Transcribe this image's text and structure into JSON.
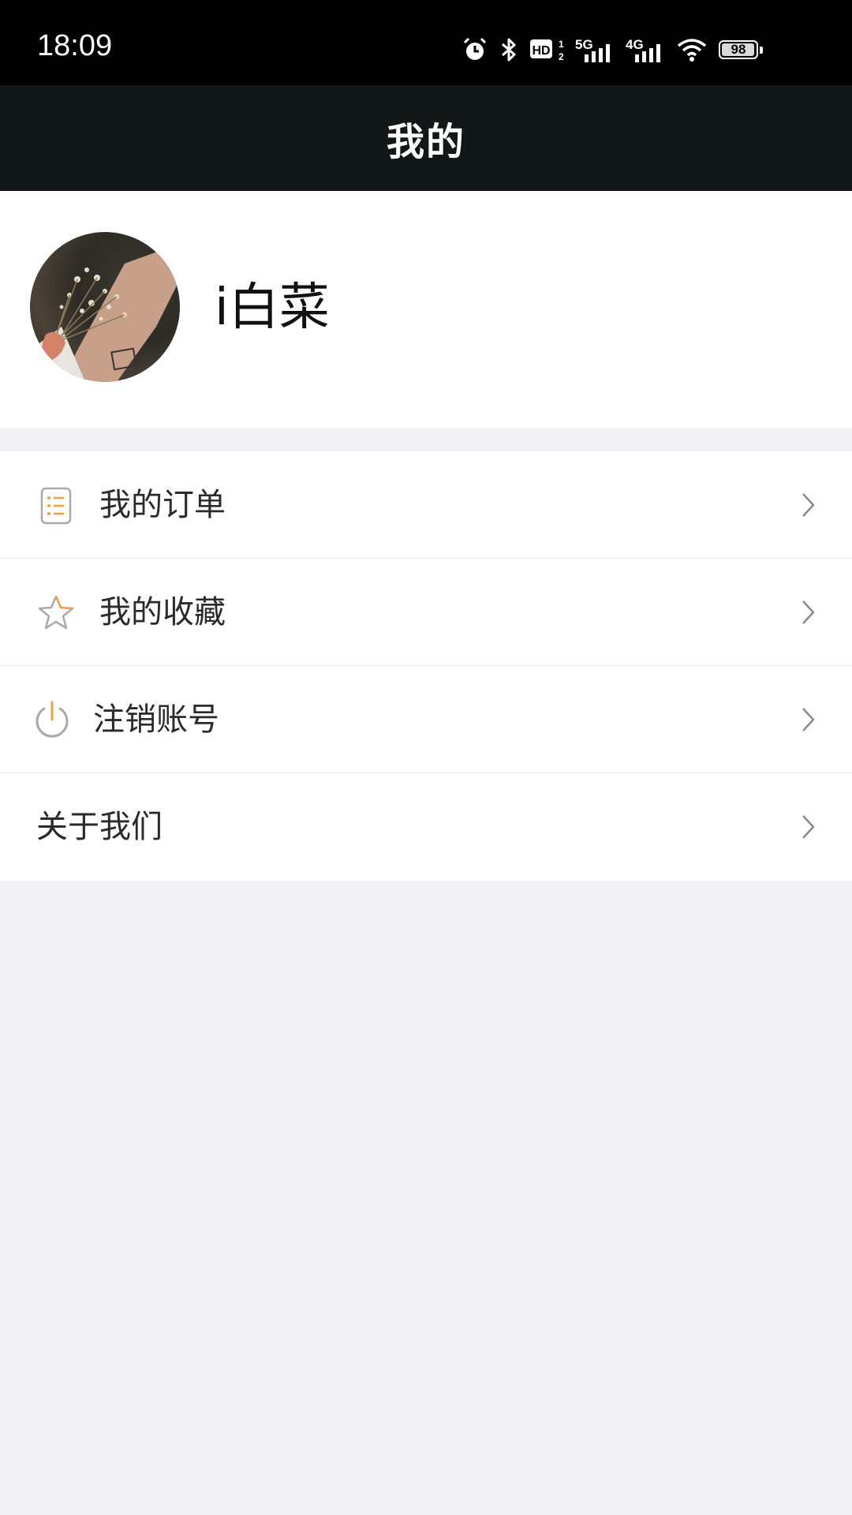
{
  "status_bar": {
    "time": "18:09",
    "network_labels": [
      "5G",
      "4G"
    ],
    "hd_label": "HD",
    "battery_level": "98",
    "icons": [
      "alarm-icon",
      "bluetooth-icon",
      "hd-icon",
      "signal-5g-icon",
      "signal-4g-icon",
      "wifi-icon",
      "battery-icon"
    ]
  },
  "header": {
    "title": "我的"
  },
  "profile": {
    "username": "i白菜"
  },
  "menu": {
    "items": [
      {
        "label": "我的订单",
        "icon": "order-list-icon"
      },
      {
        "label": "我的收藏",
        "icon": "star-icon"
      },
      {
        "label": "注销账号",
        "icon": "power-icon"
      },
      {
        "label": "关于我们",
        "icon": ""
      }
    ]
  },
  "colors": {
    "status_bar_bg": "#000000",
    "header_bg": "#121718",
    "page_bg": "#f3f3f5",
    "accent_orange": "#f0a040",
    "icon_gray": "#a9a9a9"
  }
}
